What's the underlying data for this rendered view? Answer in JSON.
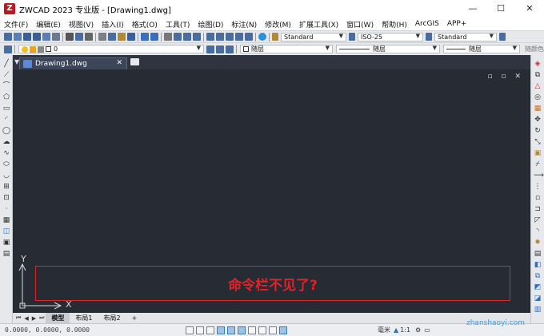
{
  "window": {
    "title": "ZWCAD 2023 专业版 - [Drawing1.dwg]",
    "logo": "Z",
    "minimize": "—",
    "maximize": "☐",
    "close": "✕"
  },
  "menu": [
    "文件(F)",
    "编辑(E)",
    "视图(V)",
    "插入(I)",
    "格式(O)",
    "工具(T)",
    "绘图(D)",
    "标注(N)",
    "修改(M)",
    "扩展工具(X)",
    "窗口(W)",
    "帮助(H)",
    "ArcGIS",
    "APP+"
  ],
  "toolbar": {
    "text_style": "Standard",
    "dim_style": "ISO-25",
    "table_style": "Standard",
    "layer": "0",
    "color": "随层",
    "linetype": "随层",
    "lineweight": "随层",
    "plot_style": "随颜色"
  },
  "document_tab": {
    "name": "Drawing1.dwg",
    "close": "✕"
  },
  "canvas": {
    "annotation": "命令栏不见了?",
    "ucs_y": "Y",
    "ucs_x": "X",
    "viewport_controls": "▫ ▫ ✕"
  },
  "layout_tabs": [
    "模型",
    "布局1",
    "布局2",
    "+"
  ],
  "status": {
    "coordinates": "0.0000, 0.0000, 0.0000",
    "units": "毫米",
    "scale": "1:1"
  },
  "watermark": "zhanshaoyi.com",
  "colors": {
    "canvas": "#262b34",
    "annotation": "#e0232a",
    "toolbar": "#e6e8ec"
  }
}
